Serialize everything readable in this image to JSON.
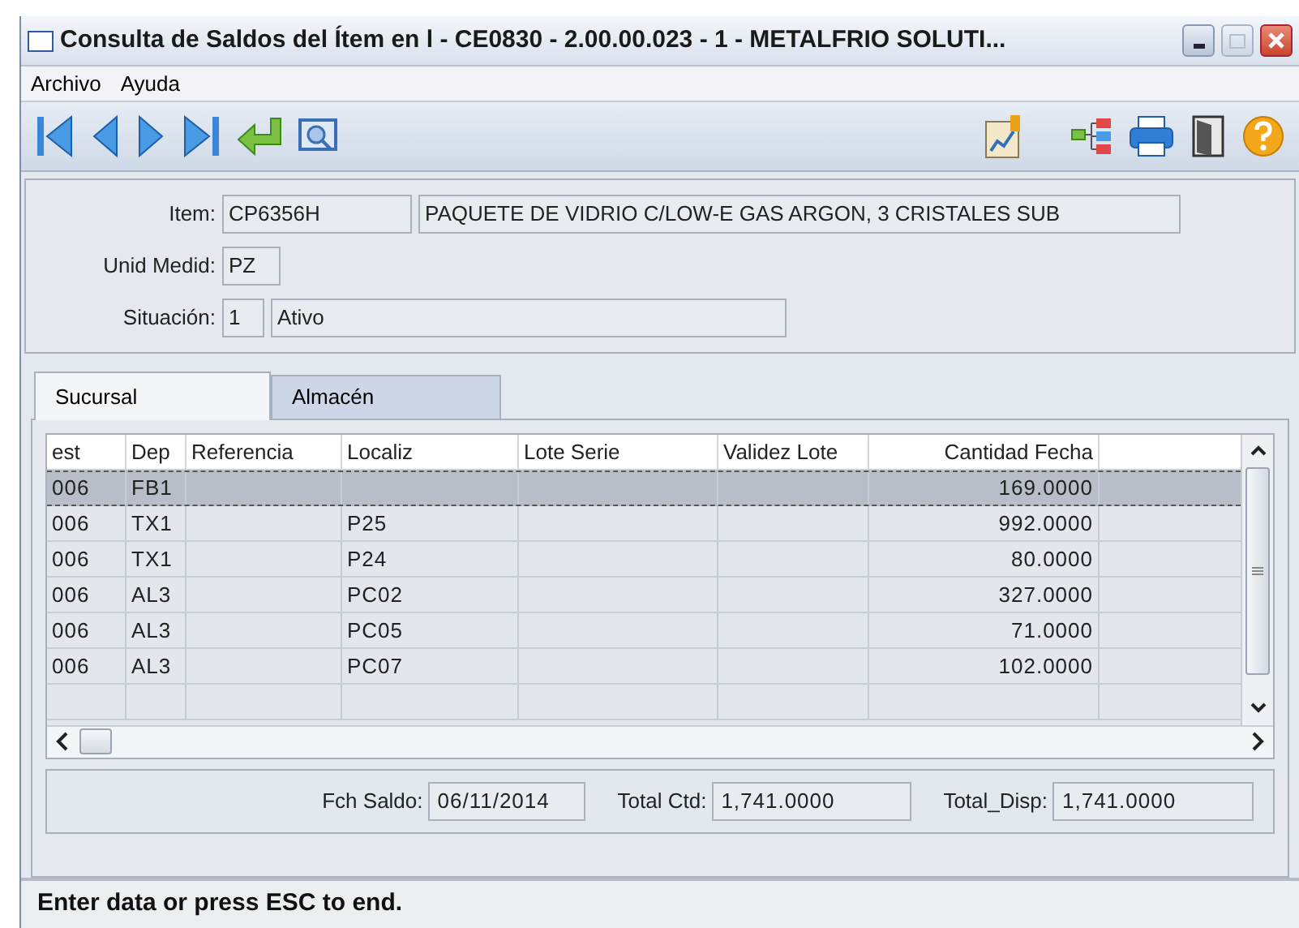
{
  "window": {
    "title": "Consulta de Saldos del Ítem en l - CE0830 - 2.00.00.023 - 1 - METALFRIO SOLUTI..."
  },
  "menu": [
    "Archivo",
    "Ayuda"
  ],
  "form": [
    {
      "label": "Item:",
      "values": [
        "CP6356H",
        "PAQUETE DE VIDRIO C/LOW-E GAS ARGON, 3 CRISTALES SUB"
      ]
    },
    {
      "label": "Unid Medid:",
      "values": [
        "PZ"
      ]
    },
    {
      "label": "Situación:",
      "values": [
        "1",
        "Ativo"
      ]
    }
  ],
  "tabs": [
    {
      "label": "Sucursal",
      "selected": true
    },
    {
      "label": "Almacén",
      "selected": false
    }
  ],
  "table": {
    "columns": [
      "est",
      "Dep",
      "Referencia",
      "Localiz",
      "Lote Serie",
      "Validez Lote",
      "Cantidad Fecha"
    ],
    "rows": [
      {
        "cells": [
          "006",
          "FB1",
          "",
          "",
          "",
          "",
          "169.0000"
        ],
        "selected": true
      },
      {
        "cells": [
          "006",
          "TX1",
          "",
          "P25",
          "",
          "",
          "992.0000"
        ],
        "selected": false
      },
      {
        "cells": [
          "006",
          "TX1",
          "",
          "P24",
          "",
          "",
          "80.0000"
        ],
        "selected": false
      },
      {
        "cells": [
          "006",
          "AL3",
          "",
          "PC02",
          "",
          "",
          "327.0000"
        ],
        "selected": false
      },
      {
        "cells": [
          "006",
          "AL3",
          "",
          "PC05",
          "",
          "",
          "71.0000"
        ],
        "selected": false
      },
      {
        "cells": [
          "006",
          "AL3",
          "",
          "PC07",
          "",
          "",
          "102.0000"
        ],
        "selected": false
      }
    ]
  },
  "totals": [
    {
      "label": "Fch Saldo:",
      "value": "06/11/2014"
    },
    {
      "label": "Total Ctd:",
      "value": "1,741.0000"
    },
    {
      "label": "Total_Disp:",
      "value": "1,741.0000"
    }
  ],
  "status_bar": "Enter data or press ESC to end."
}
